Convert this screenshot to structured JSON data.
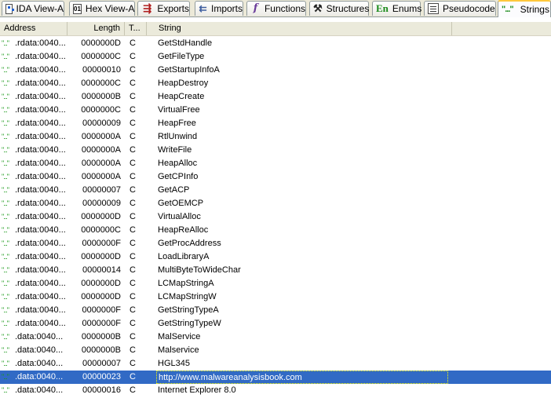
{
  "tabs": [
    {
      "label": "IDA View-A",
      "icon": "ida-view-icon"
    },
    {
      "label": "Hex View-A",
      "icon": "hex-view-icon"
    },
    {
      "label": "Exports",
      "icon": "exports-icon"
    },
    {
      "label": "Imports",
      "icon": "imports-icon"
    },
    {
      "label": "Functions",
      "icon": "functions-icon"
    },
    {
      "label": "Structures",
      "icon": "structures-icon"
    },
    {
      "label": "Enums",
      "icon": "enums-icon",
      "icon_text": "En"
    },
    {
      "label": "Pseudocode",
      "icon": "pseudocode-icon"
    },
    {
      "label": "Strings",
      "icon": "strings-icon",
      "icon_text": "\"...\""
    }
  ],
  "active_tab": "Strings",
  "columns": {
    "address": "Address",
    "length": "Length",
    "type": "T...",
    "string": "String"
  },
  "row_marker": "\"...\"",
  "rows": [
    {
      "address": ".rdata:0040...",
      "length": "0000000D",
      "type": "C",
      "string": "GetStdHandle"
    },
    {
      "address": ".rdata:0040...",
      "length": "0000000C",
      "type": "C",
      "string": "GetFileType"
    },
    {
      "address": ".rdata:0040...",
      "length": "00000010",
      "type": "C",
      "string": "GetStartupInfoA"
    },
    {
      "address": ".rdata:0040...",
      "length": "0000000C",
      "type": "C",
      "string": "HeapDestroy"
    },
    {
      "address": ".rdata:0040...",
      "length": "0000000B",
      "type": "C",
      "string": "HeapCreate"
    },
    {
      "address": ".rdata:0040...",
      "length": "0000000C",
      "type": "C",
      "string": "VirtualFree"
    },
    {
      "address": ".rdata:0040...",
      "length": "00000009",
      "type": "C",
      "string": "HeapFree"
    },
    {
      "address": ".rdata:0040...",
      "length": "0000000A",
      "type": "C",
      "string": "RtlUnwind"
    },
    {
      "address": ".rdata:0040...",
      "length": "0000000A",
      "type": "C",
      "string": "WriteFile"
    },
    {
      "address": ".rdata:0040...",
      "length": "0000000A",
      "type": "C",
      "string": "HeapAlloc"
    },
    {
      "address": ".rdata:0040...",
      "length": "0000000A",
      "type": "C",
      "string": "GetCPInfo"
    },
    {
      "address": ".rdata:0040...",
      "length": "00000007",
      "type": "C",
      "string": "GetACP"
    },
    {
      "address": ".rdata:0040...",
      "length": "00000009",
      "type": "C",
      "string": "GetOEMCP"
    },
    {
      "address": ".rdata:0040...",
      "length": "0000000D",
      "type": "C",
      "string": "VirtualAlloc"
    },
    {
      "address": ".rdata:0040...",
      "length": "0000000C",
      "type": "C",
      "string": "HeapReAlloc"
    },
    {
      "address": ".rdata:0040...",
      "length": "0000000F",
      "type": "C",
      "string": "GetProcAddress"
    },
    {
      "address": ".rdata:0040...",
      "length": "0000000D",
      "type": "C",
      "string": "LoadLibraryA"
    },
    {
      "address": ".rdata:0040...",
      "length": "00000014",
      "type": "C",
      "string": "MultiByteToWideChar"
    },
    {
      "address": ".rdata:0040...",
      "length": "0000000D",
      "type": "C",
      "string": "LCMapStringA"
    },
    {
      "address": ".rdata:0040...",
      "length": "0000000D",
      "type": "C",
      "string": "LCMapStringW"
    },
    {
      "address": ".rdata:0040...",
      "length": "0000000F",
      "type": "C",
      "string": "GetStringTypeA"
    },
    {
      "address": ".rdata:0040...",
      "length": "0000000F",
      "type": "C",
      "string": "GetStringTypeW"
    },
    {
      "address": ".data:0040...",
      "length": "0000000B",
      "type": "C",
      "string": "MalService"
    },
    {
      "address": ".data:0040...",
      "length": "0000000B",
      "type": "C",
      "string": "Malservice"
    },
    {
      "address": ".data:0040...",
      "length": "00000007",
      "type": "C",
      "string": "HGL345"
    },
    {
      "address": ".data:0040...",
      "length": "00000023",
      "type": "C",
      "string": "http://www.malwareanalysisbook.com",
      "selected": true
    },
    {
      "address": ".data:0040...",
      "length": "00000016",
      "type": "C",
      "string": "Internet Explorer 8.0"
    }
  ],
  "colors": {
    "selection": "#316ac5",
    "marker": "#1a9a1a",
    "active_tab_accent": "#ffc83c",
    "tabbar_bg": "#ece9d8"
  }
}
